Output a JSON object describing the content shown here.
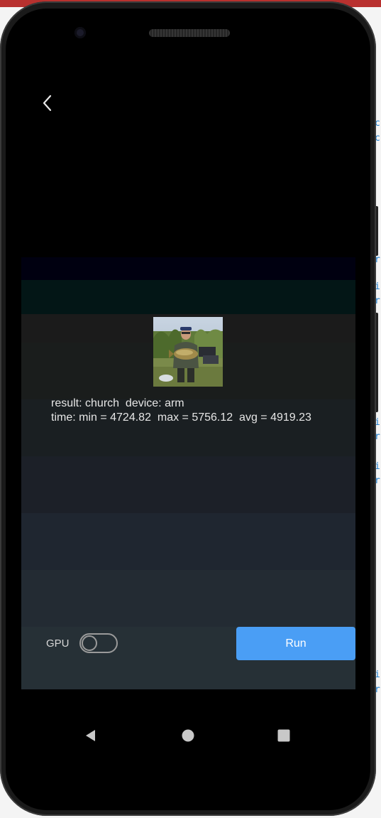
{
  "colors": {
    "accent": "#4a9ef5",
    "text": "#e6e6e6",
    "screen_bg": "#000000"
  },
  "header": {
    "back_icon": "chevron-left-icon"
  },
  "result": {
    "line1": "result: church  device: arm",
    "line2": "time: min = 4724.82  max = 5756.12  avg = 4919.23"
  },
  "controls": {
    "gpu_label": "GPU",
    "gpu_enabled": false,
    "run_label": "Run"
  },
  "nav": {
    "back_icon": "triangle-back-icon",
    "home_icon": "circle-home-icon",
    "recents_icon": "square-recents-icon"
  },
  "side_code": {
    "chars": [
      "c",
      "c",
      "r",
      "i",
      "r",
      "i",
      "r",
      "i",
      "r",
      "i",
      "r"
    ]
  }
}
